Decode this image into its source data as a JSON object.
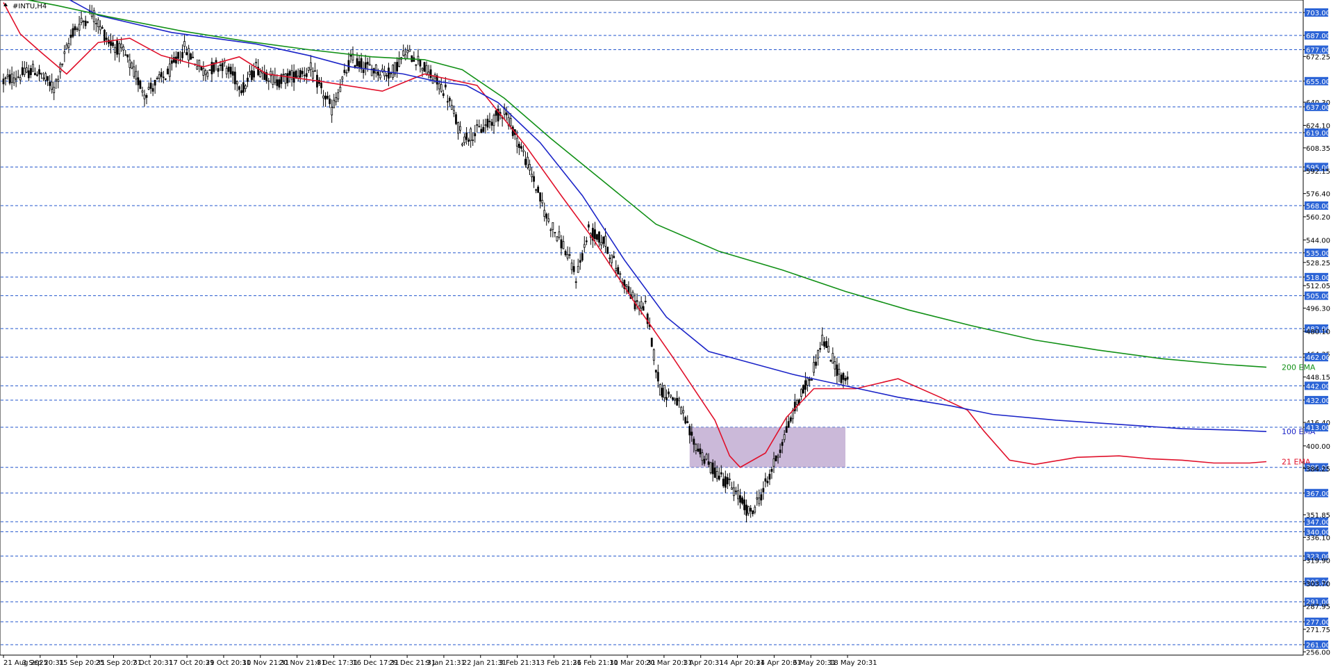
{
  "chart_data": {
    "type": "candlestick",
    "title": "#INTU,H4",
    "ylim": [
      256,
      708
    ],
    "y_ticks": [
      "703.00",
      "687.00",
      "677.00",
      "672.25",
      "655.00",
      "640.30",
      "637.00",
      "624.10",
      "619.00",
      "608.35",
      "595.00",
      "592.15",
      "576.40",
      "568.00",
      "560.20",
      "544.00",
      "535.00",
      "528.25",
      "518.00",
      "512.05",
      "505.00",
      "496.30",
      "482.00",
      "480.10",
      "464.35",
      "462.00",
      "448.15",
      "442.00",
      "432.00",
      "416.40",
      "413.00",
      "400.00",
      "385.00",
      "384.25",
      "367.00",
      "351.85",
      "347.00",
      "340.00",
      "336.10",
      "323.00",
      "319.90",
      "305.00",
      "303.70",
      "291.00",
      "287.95",
      "277.00",
      "271.75",
      "261.00",
      "256.00"
    ],
    "tick_values": [
      703,
      687,
      677,
      672.25,
      655,
      640.3,
      637,
      624.1,
      619,
      608.35,
      595,
      592.15,
      576.4,
      568,
      560.2,
      544,
      535,
      528.25,
      518,
      512.05,
      505,
      496.3,
      482,
      480.1,
      464.35,
      462,
      448.15,
      442,
      432,
      416.4,
      413,
      400,
      385,
      384.25,
      367,
      351.85,
      347,
      340,
      336.1,
      323,
      319.9,
      305,
      303.7,
      291,
      287.95,
      277,
      271.75,
      261,
      256
    ],
    "levels": [
      703,
      687,
      677,
      655,
      637,
      619,
      595,
      568,
      535,
      518,
      505,
      482,
      462,
      442,
      432,
      413,
      385,
      367,
      347,
      340,
      323,
      305,
      291,
      277,
      261
    ],
    "x_labels": [
      "21 Aug 2025",
      "3 Sep 20:31",
      "15 Sep 20:31",
      "25 Sep 20:31",
      "7 Oct 20:31",
      "17 Oct 20:31",
      "29 Oct 20:31",
      "10 Nov 21:31",
      "20 Nov 21:31",
      "4 Dec 17:31",
      "16 Dec 17:31",
      "29 Dec 21:31",
      "9 Jan 21:31",
      "22 Jan 21:31",
      "3 Feb 21:31",
      "13 Feb 21:31",
      "26 Feb 21:31",
      "10 Mar 20:31",
      "20 Mar 20:31",
      "1 Apr 20:31",
      "14 Apr 20:31",
      "24 Apr 20:31",
      "6 May 20:31",
      "18 May 20:31"
    ],
    "bars": 402,
    "range_box": {
      "low": 385,
      "high": 413
    },
    "anchors": [
      [
        0,
        655
      ],
      [
        15,
        663
      ],
      [
        24,
        650
      ],
      [
        33,
        690
      ],
      [
        42,
        703
      ],
      [
        50,
        683
      ],
      [
        57,
        675
      ],
      [
        67,
        647
      ],
      [
        78,
        660
      ],
      [
        86,
        678
      ],
      [
        95,
        662
      ],
      [
        104,
        667
      ],
      [
        114,
        650
      ],
      [
        120,
        665
      ],
      [
        130,
        655
      ],
      [
        146,
        663
      ],
      [
        156,
        635
      ],
      [
        165,
        670
      ],
      [
        172,
        665
      ],
      [
        184,
        660
      ],
      [
        191,
        675
      ],
      [
        197,
        670
      ],
      [
        202,
        660
      ],
      [
        210,
        648
      ],
      [
        218,
        615
      ],
      [
        228,
        622
      ],
      [
        238,
        635
      ],
      [
        250,
        594
      ],
      [
        258,
        560
      ],
      [
        266,
        540
      ],
      [
        272,
        518
      ],
      [
        278,
        550
      ],
      [
        286,
        542
      ],
      [
        291,
        525
      ],
      [
        300,
        500
      ],
      [
        305,
        497
      ],
      [
        312,
        440
      ],
      [
        320,
        432
      ],
      [
        327,
        405
      ],
      [
        336,
        385
      ],
      [
        345,
        373
      ],
      [
        355,
        352
      ],
      [
        363,
        375
      ],
      [
        368,
        395
      ],
      [
        377,
        430
      ],
      [
        384,
        450
      ],
      [
        389,
        475
      ],
      [
        398,
        448
      ],
      [
        406,
        440
      ],
      [
        416,
        455
      ],
      [
        423,
        450
      ],
      [
        430,
        448
      ],
      [
        439,
        428
      ],
      [
        448,
        426
      ],
      [
        456,
        418
      ],
      [
        466,
        372
      ],
      [
        472,
        345
      ],
      [
        479,
        368
      ],
      [
        484,
        387
      ],
      [
        492,
        398
      ],
      [
        498,
        383
      ],
      [
        508,
        392
      ],
      [
        518,
        397
      ],
      [
        529,
        395
      ],
      [
        538,
        398
      ],
      [
        549,
        385
      ],
      [
        558,
        376
      ],
      [
        562,
        372
      ],
      [
        569,
        393
      ],
      [
        578,
        395
      ],
      [
        584,
        385
      ],
      [
        590,
        393
      ],
      [
        595,
        402
      ],
      [
        600,
        393
      ]
    ],
    "series": [
      {
        "name": "21 EMA",
        "color": "#e0102a",
        "label_value": 389,
        "points": [
          [
            0,
            710
          ],
          [
            8,
            688
          ],
          [
            18,
            675
          ],
          [
            30,
            660
          ],
          [
            45,
            682
          ],
          [
            60,
            685
          ],
          [
            75,
            673
          ],
          [
            95,
            665
          ],
          [
            112,
            672
          ],
          [
            125,
            660
          ],
          [
            150,
            655
          ],
          [
            180,
            648
          ],
          [
            200,
            660
          ],
          [
            225,
            652
          ],
          [
            248,
            610
          ],
          [
            265,
            575
          ],
          [
            280,
            545
          ],
          [
            300,
            500
          ],
          [
            318,
            462
          ],
          [
            338,
            418
          ],
          [
            345,
            393
          ],
          [
            350,
            385
          ],
          [
            362,
            395
          ],
          [
            372,
            420
          ],
          [
            385,
            440
          ],
          [
            405,
            440
          ],
          [
            425,
            447
          ],
          [
            445,
            434
          ],
          [
            458,
            425
          ],
          [
            466,
            410
          ],
          [
            478,
            390
          ],
          [
            490,
            387
          ],
          [
            510,
            392
          ],
          [
            530,
            393
          ],
          [
            545,
            391
          ],
          [
            560,
            390
          ],
          [
            575,
            388
          ],
          [
            592,
            388
          ],
          [
            600,
            389
          ]
        ]
      },
      {
        "name": "100 EMA",
        "color": "#1b24c8",
        "label_value": 410,
        "points": [
          [
            0,
            735
          ],
          [
            30,
            713
          ],
          [
            45,
            701
          ],
          [
            80,
            689
          ],
          [
            120,
            681
          ],
          [
            145,
            673
          ],
          [
            165,
            665
          ],
          [
            190,
            660
          ],
          [
            205,
            655
          ],
          [
            220,
            652
          ],
          [
            235,
            640
          ],
          [
            255,
            612
          ],
          [
            275,
            575
          ],
          [
            295,
            530
          ],
          [
            315,
            490
          ],
          [
            335,
            466
          ],
          [
            355,
            458
          ],
          [
            375,
            450
          ],
          [
            400,
            442
          ],
          [
            425,
            434
          ],
          [
            450,
            428
          ],
          [
            470,
            422
          ],
          [
            500,
            418
          ],
          [
            530,
            415
          ],
          [
            560,
            412
          ],
          [
            585,
            411
          ],
          [
            600,
            410
          ]
        ]
      },
      {
        "name": "200 EMA",
        "color": "#119016",
        "label_value": 455,
        "points": [
          [
            0,
            715
          ],
          [
            25,
            708
          ],
          [
            50,
            700
          ],
          [
            85,
            690
          ],
          [
            115,
            683
          ],
          [
            145,
            677
          ],
          [
            175,
            672
          ],
          [
            200,
            670
          ],
          [
            218,
            663
          ],
          [
            238,
            643
          ],
          [
            260,
            615
          ],
          [
            285,
            585
          ],
          [
            310,
            555
          ],
          [
            340,
            536
          ],
          [
            370,
            523
          ],
          [
            400,
            508
          ],
          [
            430,
            495
          ],
          [
            460,
            484
          ],
          [
            490,
            474
          ],
          [
            520,
            467
          ],
          [
            550,
            461
          ],
          [
            580,
            457
          ],
          [
            600,
            455
          ]
        ]
      }
    ]
  }
}
